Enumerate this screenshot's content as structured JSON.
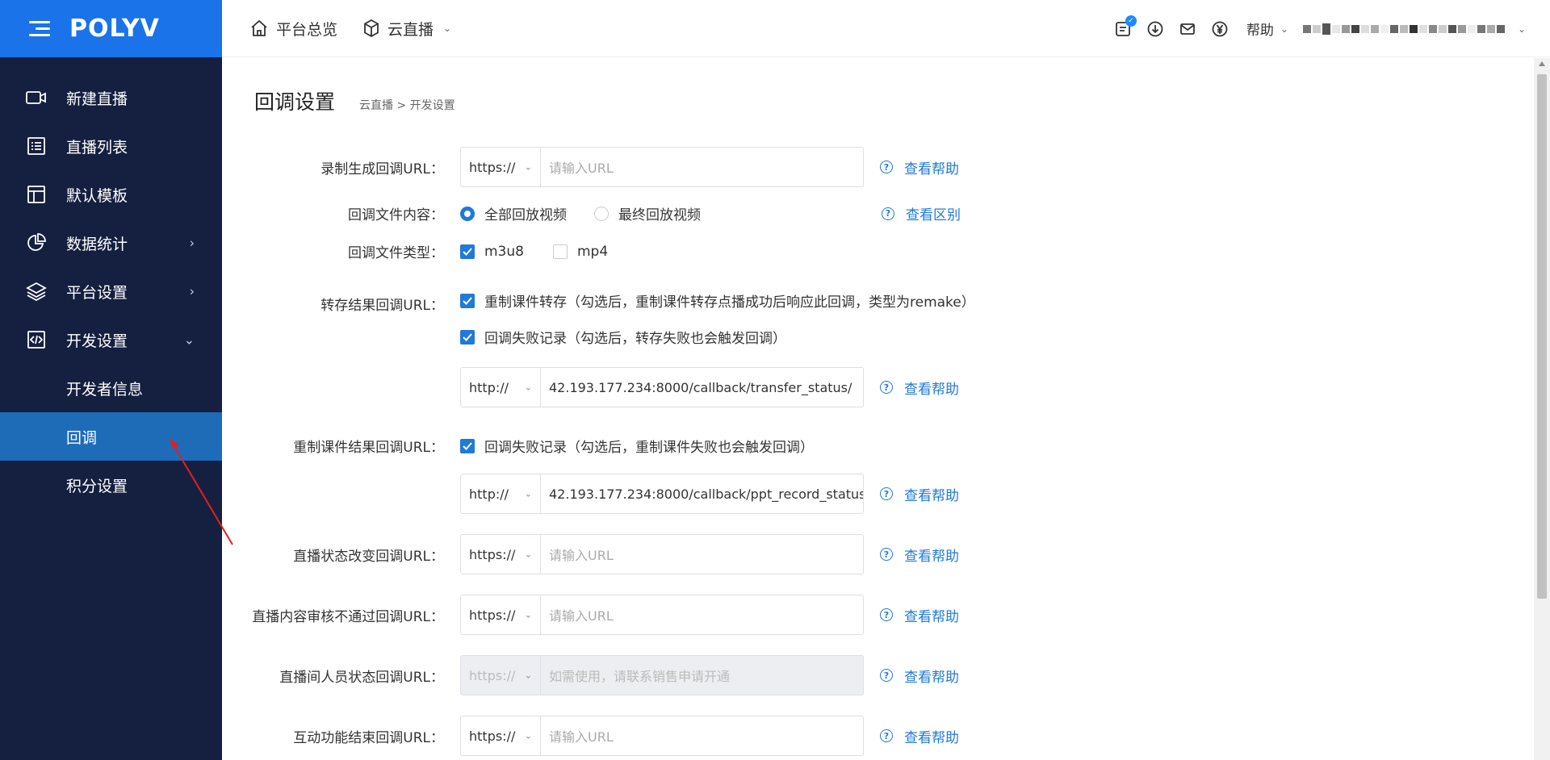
{
  "brand": {
    "logo": "POLYV",
    "accent": "#1a73e8",
    "sidebar_bg": "#152040",
    "active_bg": "#1e6bb8"
  },
  "sidebar": {
    "items": [
      {
        "label": "新建直播",
        "icon": "video-camera-icon"
      },
      {
        "label": "直播列表",
        "icon": "list-icon"
      },
      {
        "label": "默认模板",
        "icon": "template-icon"
      },
      {
        "label": "数据统计",
        "icon": "pie-chart-icon",
        "arrow": "›"
      },
      {
        "label": "平台设置",
        "icon": "layers-icon",
        "arrow": "›"
      },
      {
        "label": "开发设置",
        "icon": "code-icon",
        "arrow": "⌄"
      }
    ],
    "sub_items": [
      {
        "label": "开发者信息"
      },
      {
        "label": "回调",
        "active": true
      },
      {
        "label": "积分设置"
      }
    ]
  },
  "topbar": {
    "overview": "平台总览",
    "live": "云直播",
    "help": "帮助"
  },
  "page": {
    "title": "回调设置",
    "breadcrumb": "云直播 >  开发设置"
  },
  "form": {
    "record_url": {
      "label": "录制生成回调URL：",
      "protocol": "https://",
      "placeholder": "请输入URL",
      "help": "查看帮助"
    },
    "file_content": {
      "label": "回调文件内容：",
      "options": [
        "全部回放视频",
        "最终回放视频"
      ],
      "selected": "全部回放视频",
      "help": "查看区别"
    },
    "file_type": {
      "label": "回调文件类型：",
      "options": [
        {
          "label": "m3u8",
          "checked": true
        },
        {
          "label": "mp4",
          "checked": false
        }
      ]
    },
    "transfer": {
      "label": "转存结果回调URL：",
      "check1": "重制课件转存（勾选后，重制课件转存点播成功后响应此回调，类型为remake）",
      "check2": "回调失败记录（勾选后，转存失败也会触发回调）",
      "protocol": "http://",
      "url": "42.193.177.234:8000/callback/transfer_status/",
      "help": "查看帮助"
    },
    "ppt": {
      "label": "重制课件结果回调URL：",
      "check": "回调失败记录（勾选后，重制课件失败也会触发回调）",
      "protocol": "http://",
      "url": "42.193.177.234:8000/callback/ppt_record_status",
      "help": "查看帮助"
    },
    "status_change": {
      "label": "直播状态改变回调URL：",
      "protocol": "https://",
      "placeholder": "请输入URL",
      "help": "查看帮助"
    },
    "audit_fail": {
      "label": "直播内容审核不通过回调URL：",
      "protocol": "https://",
      "placeholder": "请输入URL",
      "help": "查看帮助"
    },
    "member_status": {
      "label": "直播间人员状态回调URL：",
      "protocol": "https://",
      "placeholder": "如需使用，请联系销售申请开通",
      "help": "查看帮助",
      "disabled": true
    },
    "interact_end": {
      "label": "互动功能结束回调URL：",
      "protocol": "https://",
      "placeholder": "请输入URL",
      "help": "查看帮助"
    }
  }
}
